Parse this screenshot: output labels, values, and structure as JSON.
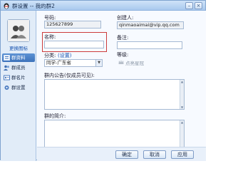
{
  "window": {
    "title": "群设置 -- 我的群2"
  },
  "sidebar": {
    "change_icon_label": "更换图标",
    "items": [
      {
        "label": "群资料",
        "active": true
      },
      {
        "label": "群成员",
        "active": false
      },
      {
        "label": "群名片",
        "active": false
      },
      {
        "label": "群设置",
        "active": false
      }
    ]
  },
  "form": {
    "number_label": "号码:",
    "number_value": "125627899",
    "creator_label": "创建人:",
    "creator_value": "qinmaoaimai@vip.qq.com",
    "name_label": "名称:",
    "name_value": "",
    "remark_label": "备注:",
    "remark_value": "",
    "category_label": "分类:",
    "category_link": "(设置)",
    "category_value": "同学-广东省",
    "grade_label": "等级:",
    "grade_value": "点亮星冠",
    "announcement_label": "群内公告(仅成员可见):",
    "intro_label": "群的简介:"
  },
  "buttons": {
    "ok": "确定",
    "cancel": "取消",
    "apply": "应用"
  },
  "colors": {
    "highlight": "#cc3b3b",
    "active_nav": "#3d73bb"
  }
}
